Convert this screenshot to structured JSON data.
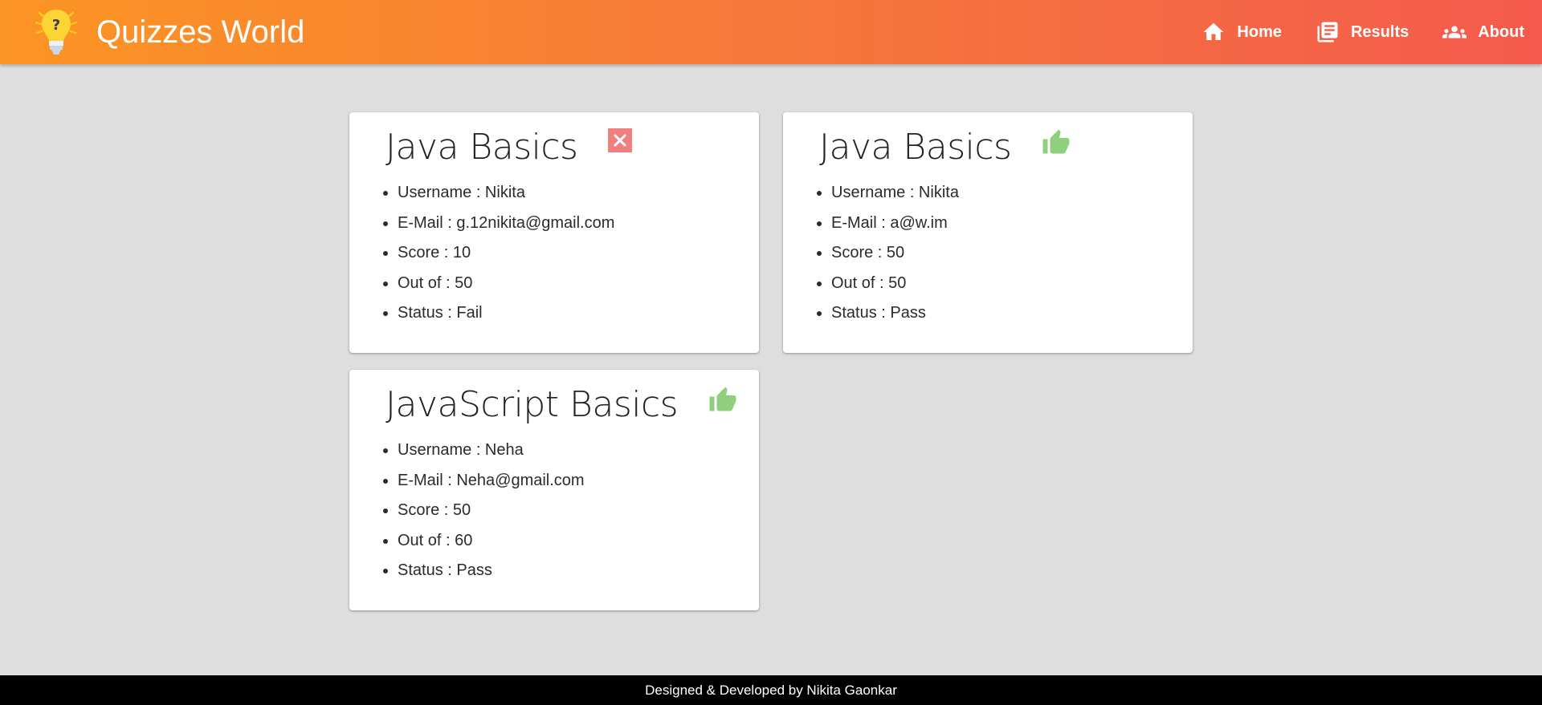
{
  "app": {
    "title": "Quizzes World",
    "logo_icon": "lightbulb-question-icon"
  },
  "nav": [
    {
      "label": "Home",
      "icon": "home-icon"
    },
    {
      "label": "Results",
      "icon": "newspaper-icon"
    },
    {
      "label": "About",
      "icon": "people-icon"
    }
  ],
  "results": [
    {
      "title": "Java Basics",
      "status_icon": "close-icon",
      "details": [
        "Username : Nikita",
        "E-Mail : g.12nikita@gmail.com",
        "Score : 10",
        "Out of : 50",
        "Status : Fail"
      ]
    },
    {
      "title": "Java Basics",
      "status_icon": "thumbs-up-icon",
      "details": [
        "Username : Nikita",
        "E-Mail : a@w.im",
        "Score : 50",
        "Out of : 50",
        "Status : Pass"
      ]
    },
    {
      "title": "JavaScript Basics",
      "status_icon": "thumbs-up-icon",
      "details": [
        "Username : Neha",
        "E-Mail : Neha@gmail.com",
        "Score : 50",
        "Out of : 60",
        "Status : Pass"
      ]
    }
  ],
  "footer": {
    "text": "Designed & Developed by Nikita Gaonkar"
  },
  "colors": {
    "header_start": "#fb9523",
    "header_end": "#f45a4d",
    "fail": "#f27f7f",
    "pass": "#8fcf7d",
    "background": "#dedede"
  }
}
